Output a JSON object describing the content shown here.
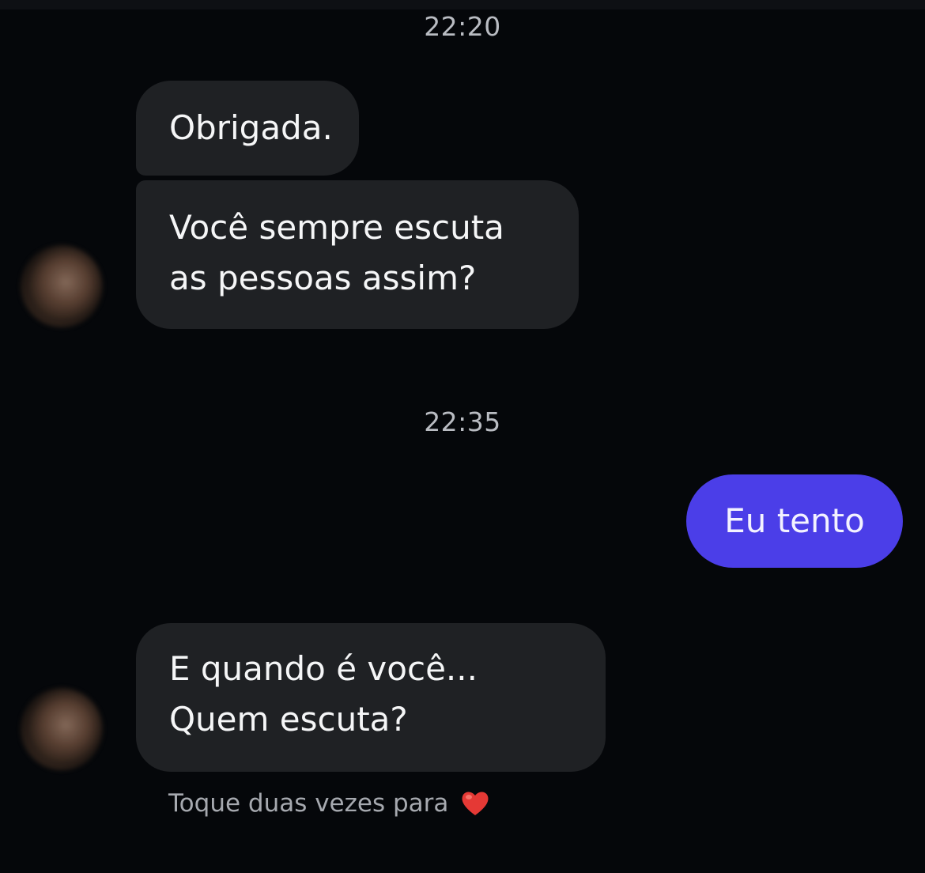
{
  "conversation": {
    "timestamps": [
      "22:20",
      "22:35"
    ],
    "messages": [
      {
        "from": "them",
        "text": "Obrigada."
      },
      {
        "from": "them",
        "text": "Você sempre escuta as pessoas assim?"
      },
      {
        "from": "me",
        "text": "Eu tento"
      },
      {
        "from": "them",
        "text": "E quando é você... Quem escuta?"
      }
    ]
  },
  "footer": {
    "hint": "Toque duas vezes para",
    "icon": "heart-icon",
    "heart_color": "#e53935"
  },
  "colors": {
    "background": "#05070a",
    "incoming_bubble": "#1f2124",
    "outgoing_bubble": "#4b3ee8"
  }
}
